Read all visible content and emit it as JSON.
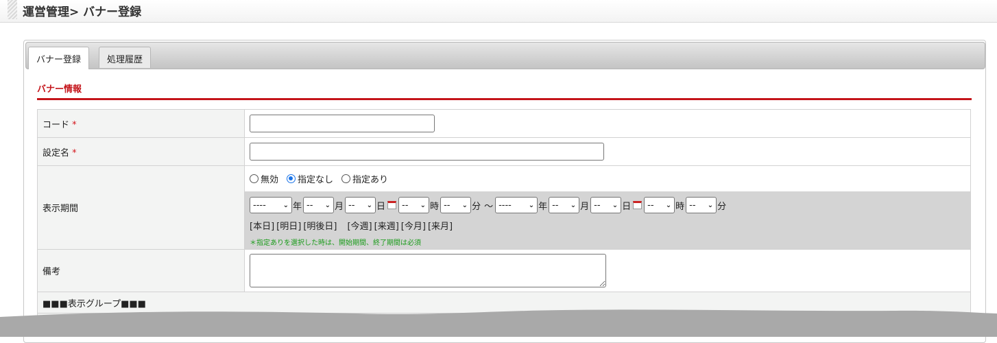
{
  "header": {
    "title": "運営管理> バナー登録"
  },
  "tabs": [
    {
      "label": "バナー登録",
      "active": true
    },
    {
      "label": "処理履歴",
      "active": false
    }
  ],
  "section": {
    "title": "バナー情報"
  },
  "form": {
    "required_mark": "*",
    "code": {
      "label": "コード",
      "value": ""
    },
    "setting_name": {
      "label": "設定名",
      "value": ""
    },
    "display_period": {
      "label": "表示期間",
      "radio_options": [
        {
          "label": "無効",
          "checked": false
        },
        {
          "label": "指定なし",
          "checked": true
        },
        {
          "label": "指定あり",
          "checked": false
        }
      ],
      "start": {
        "year": "----",
        "month": "--",
        "day": "--",
        "hour": "--",
        "minute": "--"
      },
      "end": {
        "year": "----",
        "month": "--",
        "day": "--",
        "hour": "--",
        "minute": "--"
      },
      "units": {
        "year": "年",
        "month": "月",
        "day": "日",
        "hour": "時",
        "minute": "分",
        "range": "～"
      },
      "shortcuts_day": [
        "[本日]",
        "[明日]",
        "[明後日]"
      ],
      "shortcuts_week": [
        "[今週]",
        "[来週]",
        "[今月]",
        "[来月]"
      ],
      "note": "＊指定ありを選択した時は、開始期間、終了期間は必須"
    },
    "remarks": {
      "label": "備考",
      "value": ""
    },
    "group_header": "■■■表示グループ■■■"
  },
  "colors": {
    "accent": "#c4141a",
    "note": "#1a9b1a",
    "radio": "#1a73e8"
  },
  "icons": {
    "calendar": "calendar-icon",
    "dropdown": "chevron-down-icon"
  }
}
